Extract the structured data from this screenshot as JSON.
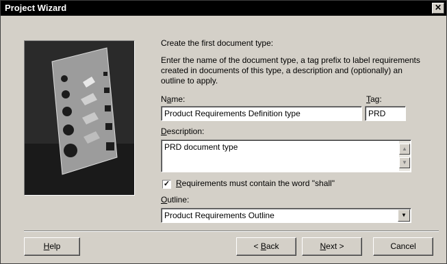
{
  "window": {
    "title": "Project Wizard",
    "close_glyph": "✕"
  },
  "intro": {
    "heading": "Create the first document type:",
    "paragraph": "Enter the name of the document type, a tag prefix to label requirements created in documents of this type, a description and (optionally) an outline to apply."
  },
  "form": {
    "name_label": "Name:",
    "name_value": "Product Requirements Definition type",
    "tag_label": "Tag:",
    "tag_value": "PRD",
    "description_label": "Description:",
    "description_value": "PRD document type",
    "shall_checkbox_label": "Requirements must contain the word \"shall\"",
    "shall_checked": true,
    "outline_label": "Outline:",
    "outline_value": "Product Requirements Outline"
  },
  "buttons": {
    "help": "Help",
    "back": "< Back",
    "next": "Next >",
    "cancel": "Cancel"
  }
}
